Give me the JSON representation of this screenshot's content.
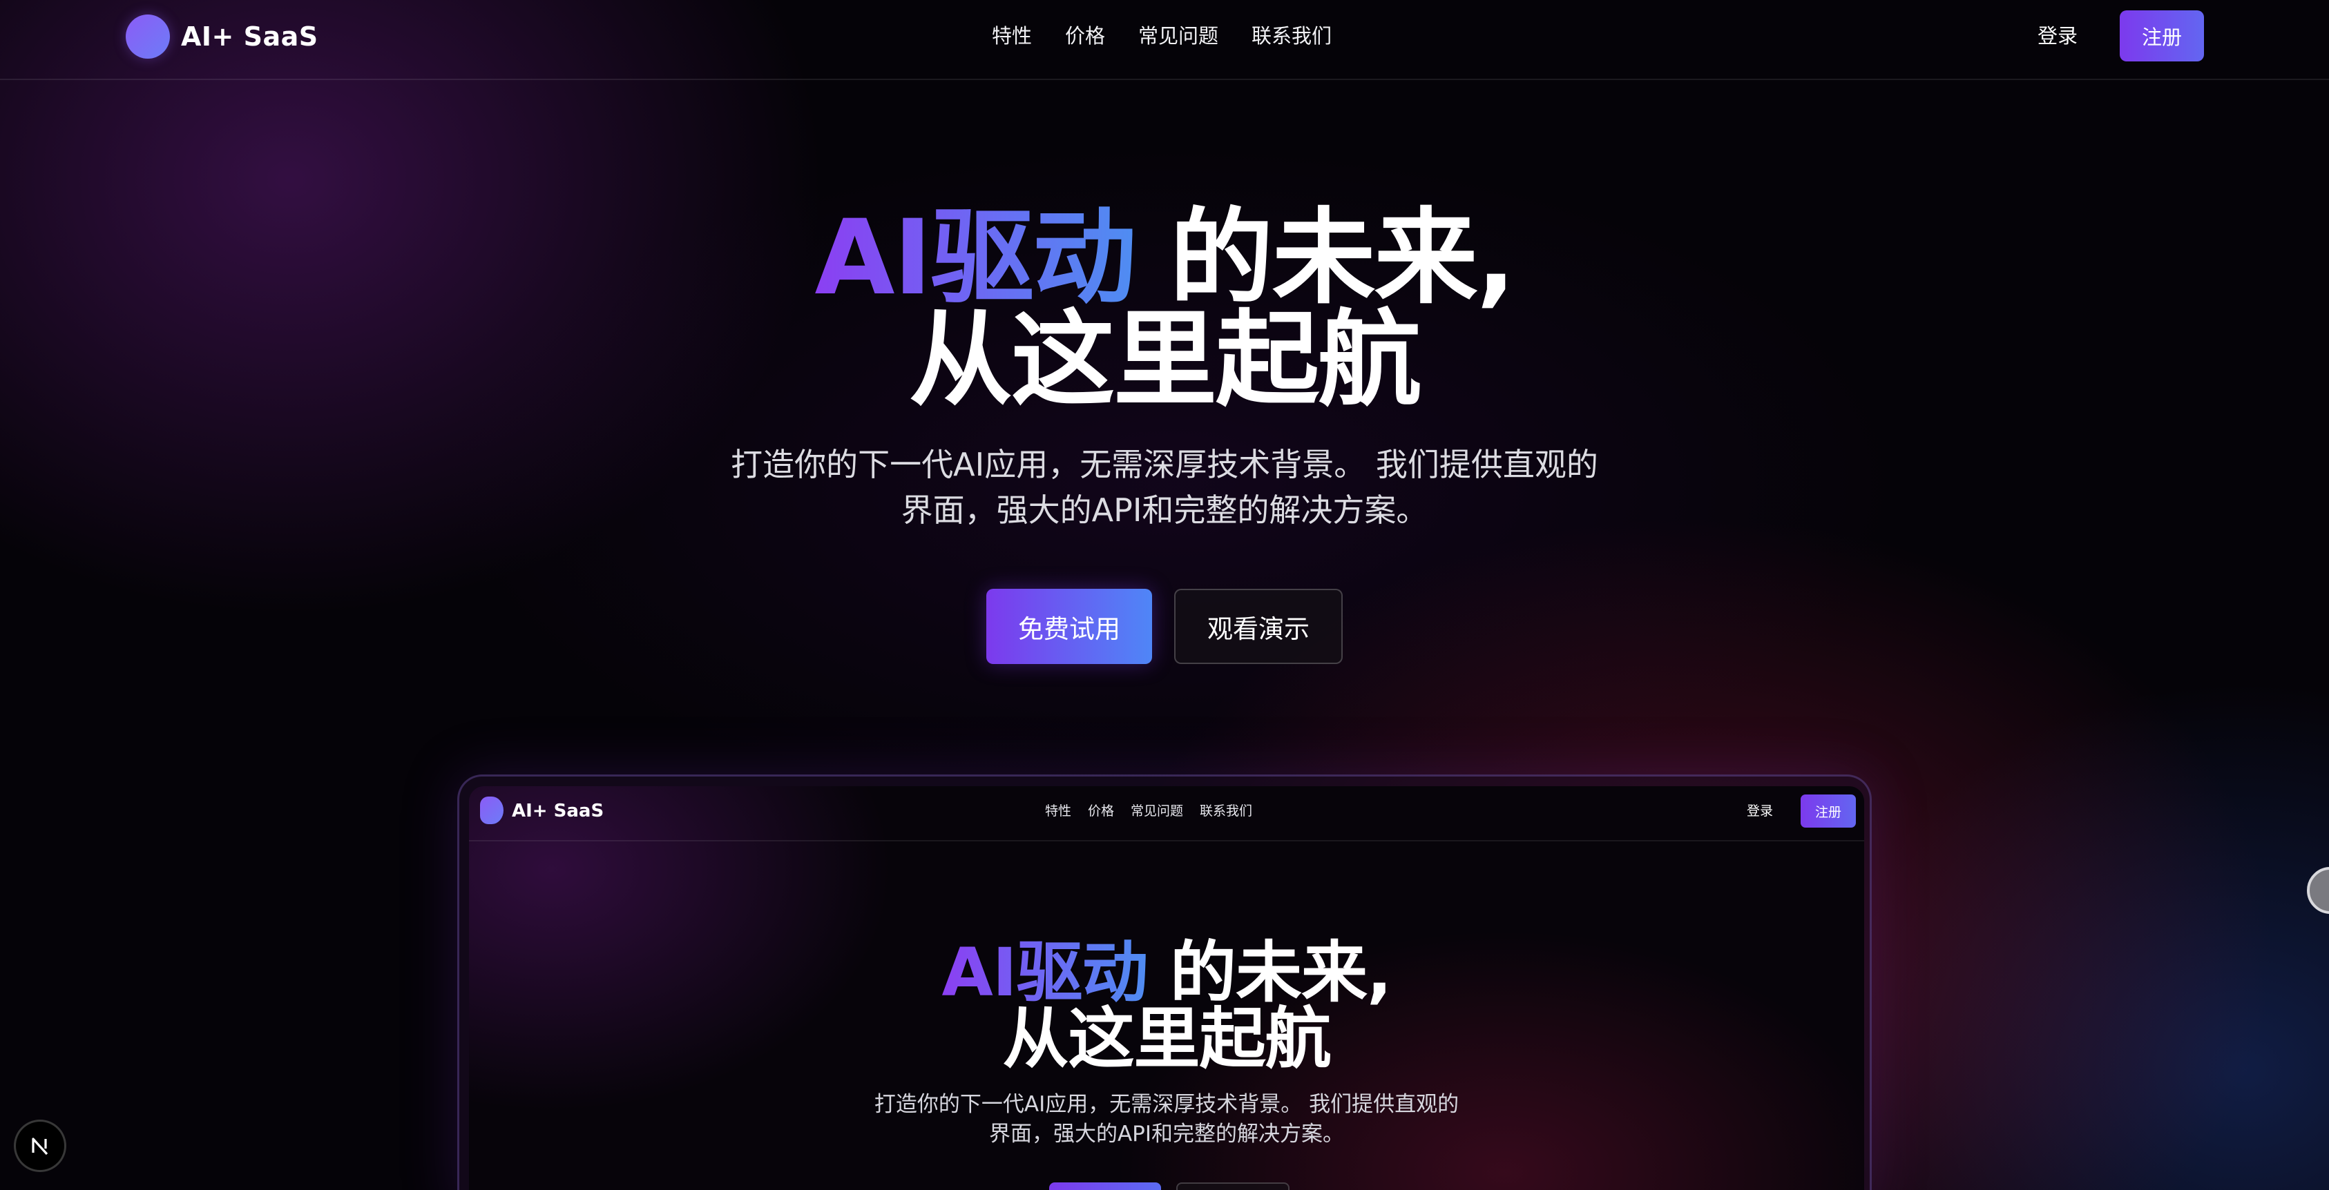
{
  "brand": {
    "name": "AI+ SaaS"
  },
  "nav": {
    "links": [
      "特性",
      "价格",
      "常见问题",
      "联系我们"
    ],
    "login": "登录",
    "signup": "注册"
  },
  "hero": {
    "title_highlight": "AI驱动",
    "title_rest": "的未来,",
    "title_line2": "从这里起航",
    "subtitle_line1": "打造你的下一代AI应用，无需深厚技术背景。 我们提供直观的",
    "subtitle_line2": "界面，强大的API和完整的解决方案。",
    "primary_cta": "免费试用",
    "secondary_cta": "观看演示"
  },
  "preview": {
    "brand": "AI+ SaaS",
    "links": [
      "特性",
      "价格",
      "常见问题",
      "联系我们"
    ],
    "login": "登录",
    "signup": "注册",
    "title_highlight": "AI驱动",
    "title_rest": "的未来,",
    "title_line2": "从这里起航",
    "subtitle_line1": "打造你的下一代AI应用，无需深厚技术背景。 我们提供直观的",
    "subtitle_line2": "界面，强大的API和完整的解决方案。"
  },
  "badge": {
    "letter": "N"
  },
  "colors": {
    "accent_purple": "#7c3aed",
    "accent_blue": "#4f86f7",
    "background": "#050308"
  }
}
